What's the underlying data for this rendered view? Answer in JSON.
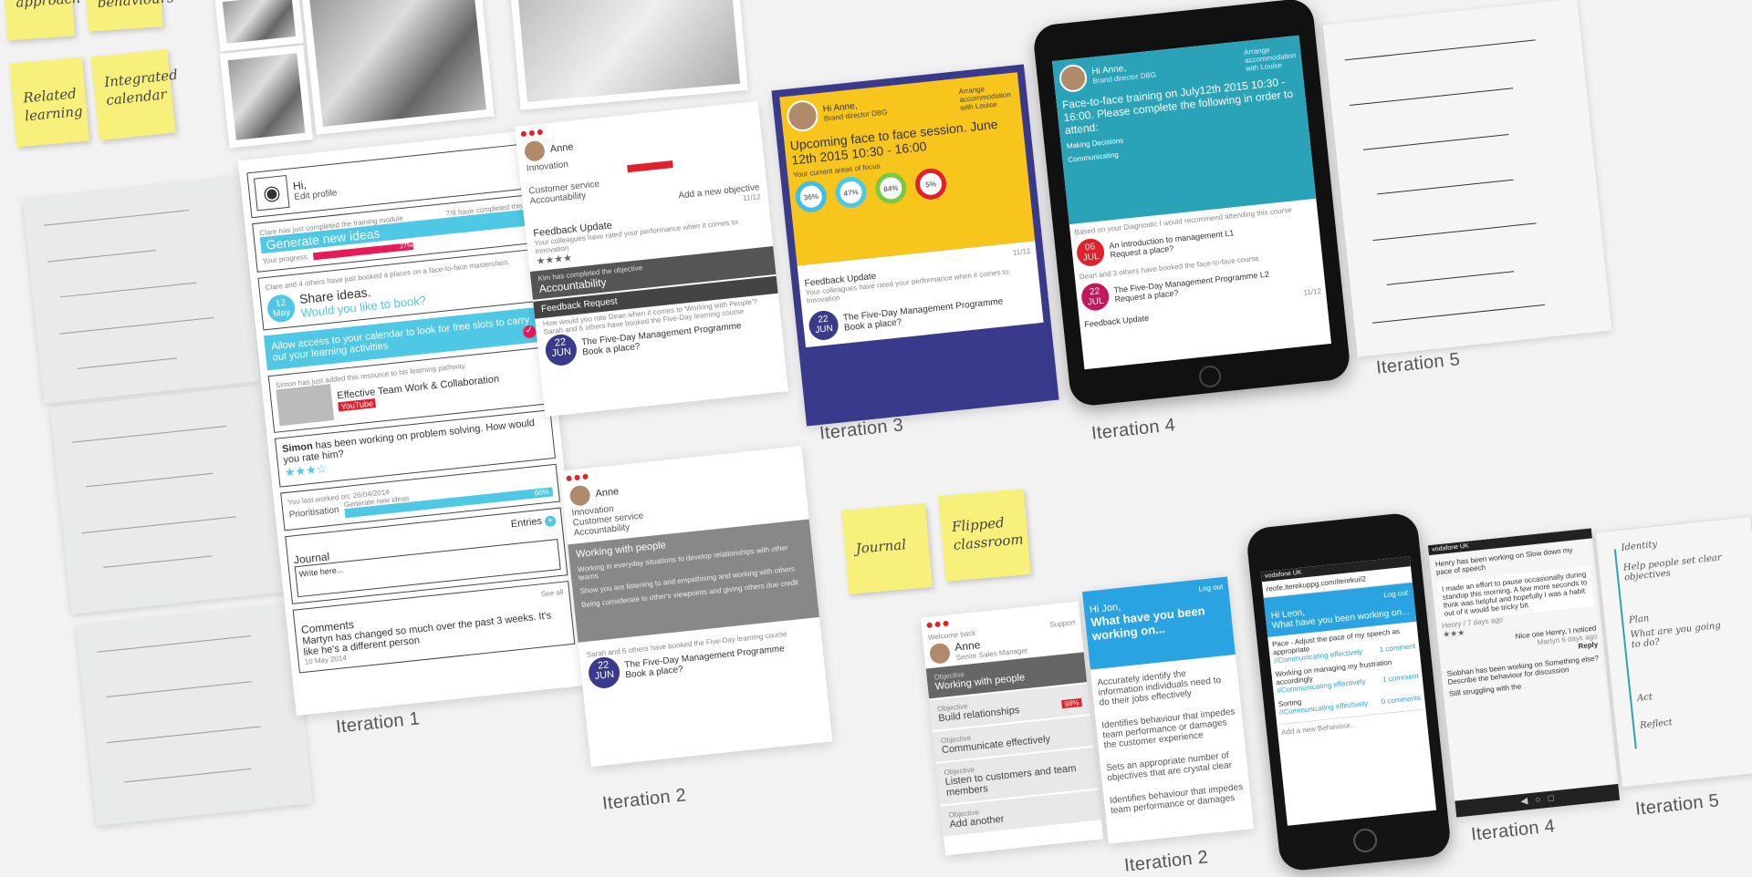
{
  "stickies": {
    "approach": "approach",
    "behaviours": "behaviours",
    "related_learning": "Related learning",
    "integrated_calendar": "Integrated calendar",
    "journal": "Journal",
    "flipped_classroom": "Flipped classroom"
  },
  "captions": {
    "it1": "Iteration 1",
    "it2a": "Iteration 2",
    "it3": "Iteration 3",
    "it4a": "Iteration 4",
    "it5a": "Iteration 5",
    "it2b": "Iteration 2",
    "it4b": "Iteration 4",
    "it5b": "Iteration 5"
  },
  "it1": {
    "hi": "Hi,",
    "edit_profile": "Edit profile",
    "clare_text": "Clare has just completed the training module",
    "completed": "7/8 have completed this",
    "generate": "Generate new ideas",
    "progress_label": "Your progress",
    "progress_value": "27%",
    "clare_booked": "Clare and 4 others have just booked a places on a face-to-face masterclass",
    "date_day": "12",
    "date_month": "May",
    "share": "Share ideas.",
    "book_q": "Would you like to book?",
    "calendar_access": "Allow access to your calendar to look for free slots to carry out your learning activities",
    "simon_added": "Simon has just added this resource to his learning pathway",
    "team_work": "Effective Team Work & Collaboration",
    "youtube": "YouTube",
    "simon_working_name": "Simon",
    "simon_working_rest": "has been working on problem solving. How would you rate him?",
    "last_worked": "You last worked on: 26/04/2014",
    "prioritisation": "Prioritisation",
    "generate_idea": "Generate new ideas",
    "pct": "60%",
    "entries": "Entries",
    "journal": "Journal",
    "write_here": "Write here...",
    "see_all": "See all",
    "comments": "Comments",
    "comment_text": "Martyn has changed so much over the past 3 weeks. It's like he's a different person",
    "comment_date": "10 May 2014"
  },
  "it2": {
    "name": "Anne",
    "objectives": [
      "Innovation",
      "Customer service",
      "Accountability"
    ],
    "add_objective": "Add a new objective",
    "page": "11/12",
    "feedback_update": "Feedback Update",
    "feedback_text": "Your colleagues have rated your performance when it comes to: Innovation",
    "kim": "Kim has completed the objective",
    "accountability": "Accountability",
    "feedback_request": "Feedback Request",
    "feedback_request_text": "How would you rate Dean when it comes to 'Working with People'?",
    "booked_text": "Sarah and 6 others have booked the Five-Day learning course",
    "date_day": "22",
    "date_month": "JUN",
    "course": "The Five-Day Management Programme",
    "book": "Book a place?",
    "working_with_people": "Working with people",
    "wwp_items": [
      "Working in everyday situations to develop relationships with other teams",
      "Show you are listening to and empathising and working with others",
      "Being considerate to other's viewpoints and giving others due credit"
    ]
  },
  "it3": {
    "hi": "Hi Anne,",
    "title": "Brand director DBG",
    "arrange": "Arrange accommodation with Louise",
    "session": "Upcoming face to face session. June 12th 2015 10:30 - 16:00",
    "focus": "Your current areas of focus",
    "rings": [
      "36%",
      "47%",
      "84%",
      "5%"
    ],
    "page": "11/12",
    "feedback_update": "Feedback Update",
    "feedback_text": "Your colleagues have rated your performance when it comes to: Innovation",
    "date_day": "22",
    "date_month": "JUN",
    "course": "The Five-Day Management Programme",
    "book": "Book a place?"
  },
  "it4": {
    "hi": "Hi Anne,",
    "title": "Brand director DBG",
    "arrange": "Arrange accommodation with Louise",
    "session": "Face-to-face training on July12th 2015 10:30 - 16:00. Please complete the following in order to attend:",
    "tasks": [
      "Making Decisions",
      "Communicating"
    ],
    "based": "Based on your Diagnostic I would recommend attending this course",
    "course1": "An introduction to management L1",
    "date1_day": "06",
    "date1_month": "JUL",
    "request": "Request a place?",
    "dean": "Dean and 3 others have booked the face-to-face course",
    "course2": "The Five-Day Management Programme L2",
    "date2_day": "22",
    "date2_month": "JUL",
    "page": "11/12",
    "feedback_update": "Feedback Update"
  },
  "it2b": {
    "welcome": "Welcome back",
    "support": "Support",
    "name": "Anne",
    "role": "Senior Sales Manager",
    "objective_label": "Objective",
    "objectives": [
      "Working with people",
      "Build relationships",
      "Communicate effectively",
      "Listen to customers and team members",
      "Add another"
    ],
    "pct": "98%",
    "logout": "Log out",
    "hi": "Hi Jon,",
    "question": "What have you been working on...",
    "items": [
      "Accurately identify the information individuals need to do their jobs effectively",
      "Identifies behaviour that impedes team performance or damages the customer experience",
      "Sets an appropriate number of objectives that are crystal clear",
      "Identifies behaviour that impedes team performance or damages"
    ]
  },
  "it4b": {
    "url": "reofe.iterekuppg.com/iterekui/2",
    "logout": "Log out",
    "hi": "Hi Leon,",
    "question": "What have you been working on...",
    "pace": "Pace - Adjust the pace of my speech as appropriate",
    "tag": "//Communicating effectively",
    "comments1": "1 comment",
    "frustration": "Working on managing my frustration accordingly",
    "comments2": "1 comment",
    "sorting": "Sorting",
    "comments3": "0 comments",
    "add": "Add a new Behaviour...",
    "henry_head": "Henry has been working on Slow down my pace of speech",
    "henry_text": "I made an effort to pause occasionally during standup this morning. A few more seconds to think was helpful and hopefully I was a habit out of it would be tricky bit.",
    "henry_date": "Henry / 7 days ago",
    "nice": "Nice one Henry, I noticed",
    "martyn": "Martyn 6 days ago",
    "reply": "Reply",
    "siobhan": "Siobhan has been working on Something else? Describe the behaviour for discussion",
    "still": "Still struggling with the"
  },
  "it5b": {
    "steps": [
      "Identity",
      "Help people set clear objectives",
      "Plan",
      "What are you going to do?",
      "Act",
      "Reflect"
    ]
  },
  "colors": {
    "pink": "#e81b5a",
    "cyan": "#4fc8e6",
    "yellow": "#f7c51c",
    "navy": "#3a3a8c",
    "teal": "#2aa3b8",
    "blue": "#2aa3e2"
  }
}
